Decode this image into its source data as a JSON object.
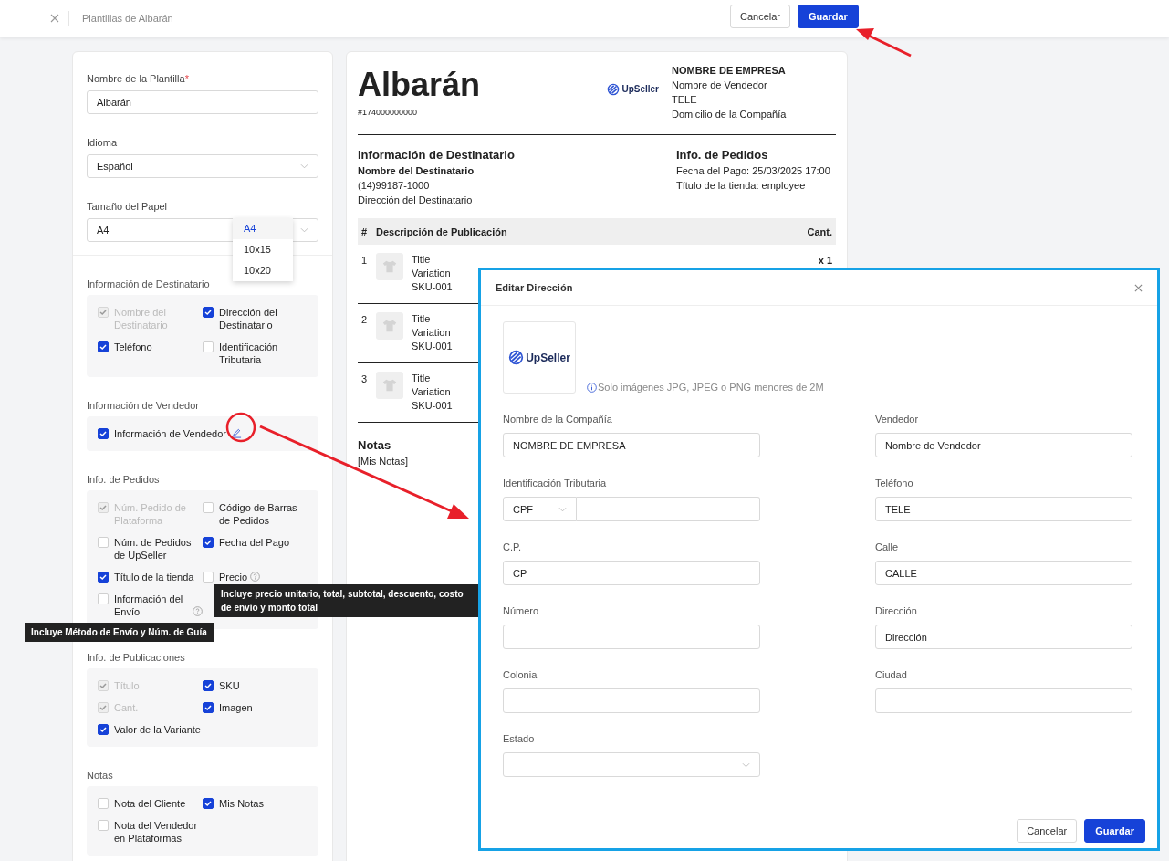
{
  "topbar": {
    "title": "Plantillas de Albarán",
    "buttons": [
      {
        "label": "Cancelar",
        "kind": "secondary"
      },
      {
        "label": "Guardar",
        "kind": "primary"
      }
    ]
  },
  "settings": {
    "fields": [
      {
        "label": "Nombre de la Plantilla",
        "required_mark": "*",
        "kind": "input",
        "value": "Albarán"
      },
      {
        "label": "Idioma",
        "kind": "select",
        "value": "Español"
      },
      {
        "label": "Tamaño del Papel",
        "kind": "select",
        "value": "A4"
      }
    ],
    "paper_options": [
      {
        "label": "A4",
        "selected": true
      },
      {
        "label": "10x15",
        "selected": false
      },
      {
        "label": "10x20",
        "selected": false
      }
    ]
  },
  "sections": [
    {
      "title": "Información de Destinatario",
      "options": [
        {
          "label": "Nombre del Destinatario",
          "checked": true,
          "disabled": true
        },
        {
          "label": "Dirección del Destinatario",
          "checked": true,
          "disabled": false
        },
        {
          "label": "Teléfono",
          "checked": true,
          "disabled": false
        },
        {
          "label": "Identificación Tributaria",
          "checked": false,
          "disabled": false
        }
      ]
    },
    {
      "title": "Información de Vendedor",
      "options": [
        {
          "label": "Información de Vendedor",
          "checked": true,
          "disabled": false,
          "kind": "edit"
        }
      ]
    },
    {
      "title": "Info. de Pedidos",
      "options": [
        {
          "label": "Núm. Pedido de Plataforma",
          "checked": true,
          "disabled": true
        },
        {
          "label": "Código de Barras de Pedidos",
          "checked": false,
          "disabled": false
        },
        {
          "label": "Núm. de Pedidos de UpSeller",
          "checked": false,
          "disabled": false
        },
        {
          "label": "Fecha del Pago",
          "checked": true,
          "disabled": false
        },
        {
          "label": "Título de la tienda",
          "checked": true,
          "disabled": false
        },
        {
          "label": "Precio",
          "checked": false,
          "disabled": false,
          "kind": "help",
          "tooltip": "Incluye precio unitario, total, subtotal, descuento, costo de envío y monto total"
        },
        {
          "label": "Información del Envío",
          "checked": false,
          "disabled": false,
          "kind": "help",
          "tooltip": "Incluye Método de Envío y Núm. de Guía"
        }
      ]
    },
    {
      "title": "Info. de Publicaciones",
      "options": [
        {
          "label": "Título",
          "checked": true,
          "disabled": true
        },
        {
          "label": "SKU",
          "checked": true,
          "disabled": false
        },
        {
          "label": "Cant.",
          "checked": true,
          "disabled": true
        },
        {
          "label": "Imagen",
          "checked": true,
          "disabled": false
        },
        {
          "label": "Valor de la Variante",
          "checked": true,
          "disabled": false
        }
      ]
    },
    {
      "title": "Notas",
      "options": [
        {
          "label": "Nota del Cliente",
          "checked": false,
          "disabled": false
        },
        {
          "label": "Mis Notas",
          "checked": true,
          "disabled": false
        },
        {
          "label": "Nota del Vendedor en Plataformas",
          "checked": false,
          "disabled": false
        }
      ]
    }
  ],
  "preview": {
    "title": "Albarán",
    "number": "#174000000000",
    "logo_text": "UpSeller",
    "company": {
      "name": "NOMBRE DE EMPRESA",
      "lines": [
        "Nombre de Vendedor",
        "TELE",
        "Domicilio de la Compañía"
      ]
    },
    "recipient": {
      "heading": "Información de Destinatario",
      "name": "Nombre del Destinatario",
      "lines": [
        "(14)99187-1000",
        "Dirección del Destinatario"
      ]
    },
    "order": {
      "heading": "Info. de Pedidos",
      "lines": [
        "Fecha del Pago: 25/03/2025 17:00",
        "Título de la tienda: employee"
      ]
    },
    "table": {
      "columns": [
        "#",
        "Descripción de Publicación",
        "Cant."
      ],
      "rows": [
        {
          "index": "1",
          "lines": [
            "Title",
            "Variation",
            "SKU-001"
          ],
          "qty": "x 1"
        },
        {
          "index": "2",
          "lines": [
            "Title",
            "Variation",
            "SKU-001"
          ]
        },
        {
          "index": "3",
          "lines": [
            "Title",
            "Variation",
            "SKU-001"
          ]
        }
      ]
    },
    "notes": {
      "heading": "Notas",
      "text": "[Mis Notas]"
    }
  },
  "modal": {
    "title": "Editar Dirección",
    "logo_text": "UpSeller",
    "hint": "Solo imágenes JPG, JPEG o PNG menores de 2M",
    "fields": [
      {
        "label": "Nombre de la Compañía",
        "kind": "input",
        "value": "NOMBRE DE EMPRESA"
      },
      {
        "label": "Vendedor",
        "kind": "input",
        "value": "Nombre de Vendedor"
      },
      {
        "label": "Identificación Tributaria",
        "kind": "prefixed",
        "prefix": "CPF"
      },
      {
        "label": "Teléfono",
        "kind": "input",
        "value": "TELE"
      },
      {
        "label": "C.P.",
        "kind": "input",
        "value": "CP"
      },
      {
        "label": "Calle",
        "kind": "input",
        "value": "CALLE"
      },
      {
        "label": "Número",
        "kind": "input"
      },
      {
        "label": "Dirección",
        "kind": "input",
        "value": "Dirección"
      },
      {
        "label": "Colonia",
        "kind": "input"
      },
      {
        "label": "Ciudad",
        "kind": "input"
      },
      {
        "label": "Estado",
        "kind": "select"
      }
    ],
    "buttons": [
      {
        "label": "Cancelar",
        "kind": "secondary"
      },
      {
        "label": "Guardar",
        "kind": "primary"
      }
    ]
  }
}
